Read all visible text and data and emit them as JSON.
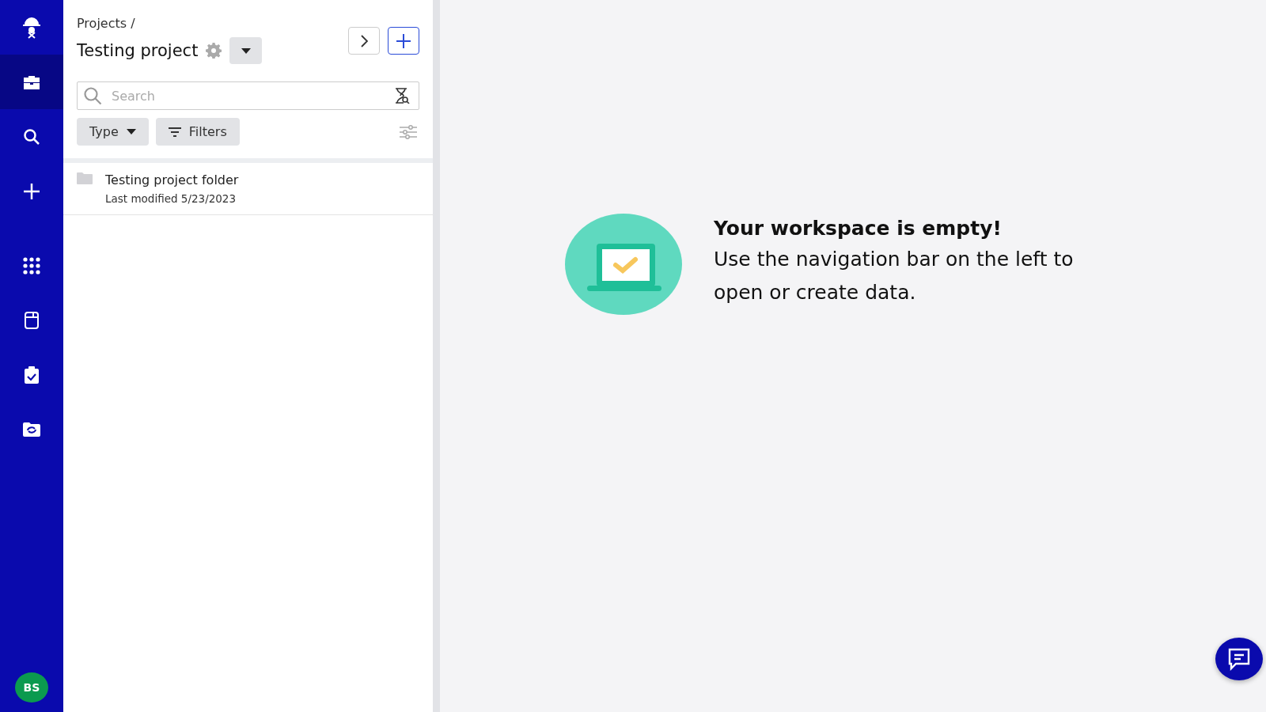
{
  "nav": {
    "items": [
      {
        "kind": "logo",
        "selected": false
      },
      {
        "kind": "briefcase",
        "selected": true
      },
      {
        "kind": "search",
        "selected": false
      },
      {
        "kind": "plus",
        "selected": false
      },
      {
        "kind": "grid",
        "selected": false
      },
      {
        "kind": "notebook",
        "selected": false
      },
      {
        "kind": "clipboard",
        "selected": false
      },
      {
        "kind": "folder-sync",
        "selected": false
      }
    ],
    "avatar": "BS"
  },
  "panel": {
    "breadcrumb": "Projects /",
    "title": "Testing project",
    "search": {
      "placeholder": "Search"
    },
    "type_button": "Type",
    "filters_button": "Filters",
    "items": [
      {
        "name": "Testing project folder",
        "modified": "Last modified 5/23/2023"
      }
    ]
  },
  "empty_state": {
    "heading": "Your workspace is empty!",
    "message": "Use the navigation bar on the left to open or create data."
  }
}
